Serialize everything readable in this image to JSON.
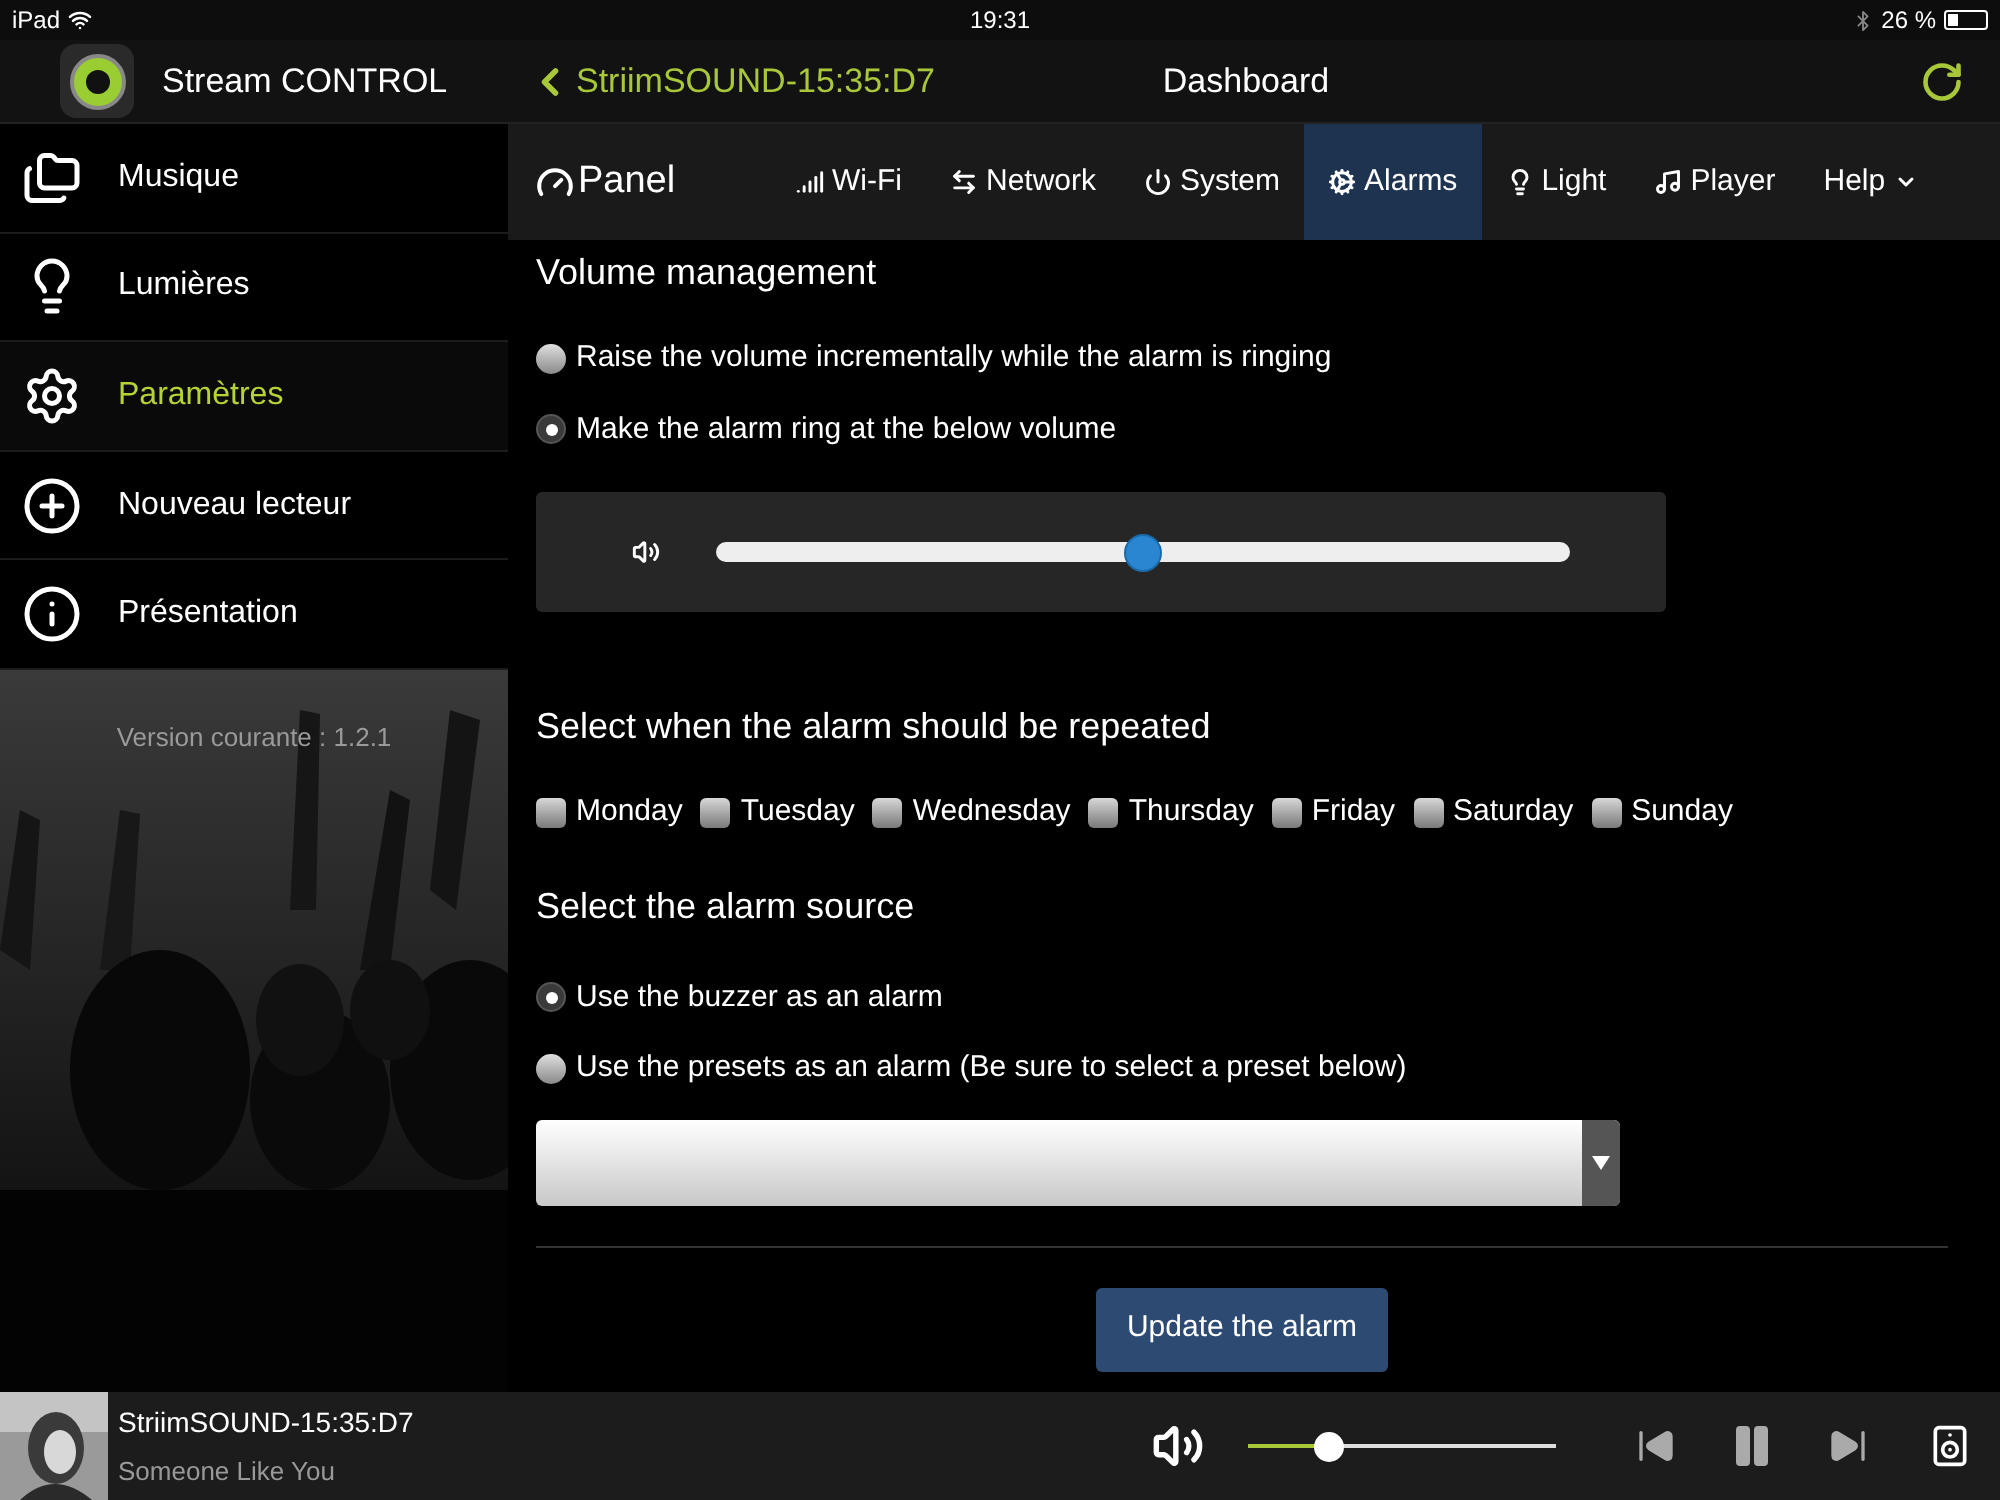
{
  "status_bar": {
    "device": "iPad",
    "time": "19:31",
    "battery": "26 %"
  },
  "header": {
    "app_name": "Stream CONTROL",
    "back_label": "StriimSOUND-15:35:D7",
    "title": "Dashboard"
  },
  "sidebar": {
    "items": [
      {
        "label": "Musique",
        "selected": false
      },
      {
        "label": "Lumières",
        "selected": false
      },
      {
        "label": "Paramètres",
        "selected": true
      },
      {
        "label": "Nouveau lecteur",
        "selected": false
      },
      {
        "label": "Présentation",
        "selected": false
      }
    ],
    "version": "Version courante : 1.2.1"
  },
  "navbar": {
    "brand": "Panel",
    "tabs": [
      {
        "label": "Wi-Fi",
        "selected": false,
        "kind": "link"
      },
      {
        "label": "Network",
        "selected": false,
        "kind": "link"
      },
      {
        "label": "System",
        "selected": false,
        "kind": "link"
      },
      {
        "label": "Alarms",
        "selected": true,
        "kind": "link"
      },
      {
        "label": "Light",
        "selected": false,
        "kind": "link"
      },
      {
        "label": "Player",
        "selected": false,
        "kind": "link"
      },
      {
        "label": "Help",
        "selected": false,
        "kind": "dropdown"
      }
    ]
  },
  "volume_section": {
    "heading": "Volume management",
    "options": [
      {
        "label": "Raise the volume incrementally while the alarm is ringing",
        "selected": false
      },
      {
        "label": "Make the alarm ring at the below volume",
        "selected": true
      }
    ],
    "volume": {
      "level": 0.5
    }
  },
  "repeat_section": {
    "heading": "Select when the alarm should be repeated",
    "days": [
      {
        "label": "Monday",
        "checked": false
      },
      {
        "label": "Tuesday",
        "checked": false
      },
      {
        "label": "Wednesday",
        "checked": false
      },
      {
        "label": "Thursday",
        "checked": false
      },
      {
        "label": "Friday",
        "checked": false
      },
      {
        "label": "Saturday",
        "checked": false
      },
      {
        "label": "Sunday",
        "checked": false
      }
    ]
  },
  "source_section": {
    "heading": "Select the alarm source",
    "options": [
      {
        "label": "Use the buzzer as an alarm",
        "selected": true
      },
      {
        "label": "Use the presets as an alarm (Be sure to select a preset below)",
        "selected": false
      }
    ]
  },
  "submit_button": "Update the alarm",
  "player": {
    "title": "StriimSOUND-15:35:D7",
    "subtitle": "Someone Like You",
    "volume": {
      "level": 0.26
    },
    "playing": true
  }
}
